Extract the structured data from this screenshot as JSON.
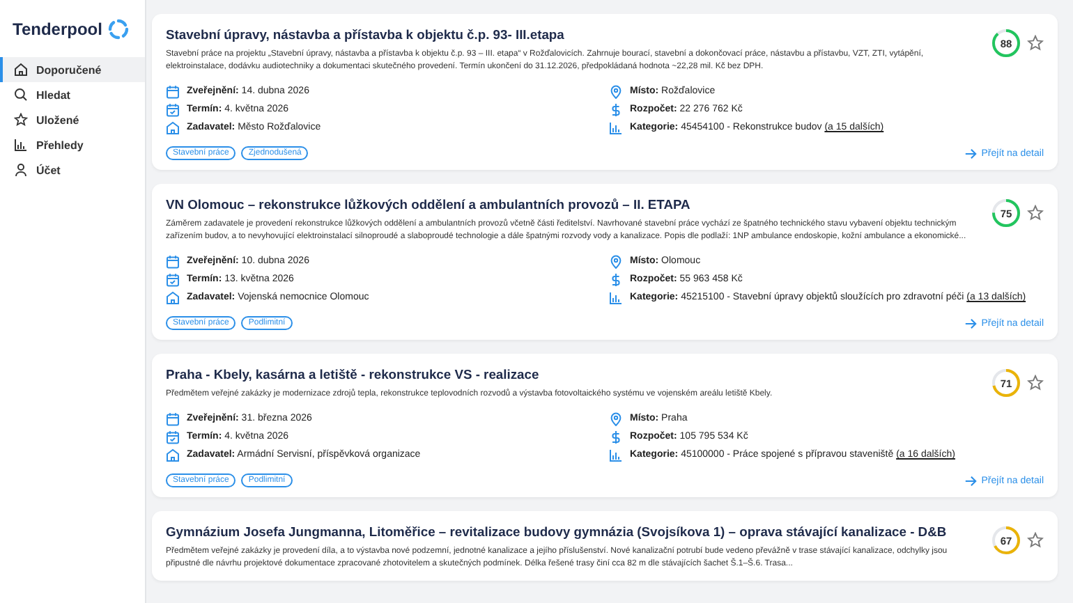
{
  "logo": {
    "text": "Tenderpool"
  },
  "sidebar": {
    "items": [
      {
        "label": "Doporučené",
        "selected": true
      },
      {
        "label": "Hledat",
        "selected": false
      },
      {
        "label": "Uložené",
        "selected": false
      },
      {
        "label": "Přehledy",
        "selected": false
      },
      {
        "label": "Účet",
        "selected": false
      }
    ]
  },
  "cards": [
    {
      "title": "Stavební úpravy, nástavba a přístavba k objektu č.p. 93- III.etapa",
      "score": "88",
      "color": "#22c55e",
      "description": "Stavební práce na projektu „Stavební úpravy, nástavba a přístavba k objektu č.p. 93 – III. etapa“ v Rožďalovicích. Zahrnuje bourací, stavební a dokončovací práce, nástavbu a přístavbu, VZT, ZTI, vytápění, elektroinstalace, dodávku audiotechniky a dokumentaci skutečného provedení. Termín ukončení do 31.12.2026, předpokládaná hodnota ~22,28 mil. Kč bez DPH.",
      "left": [
        {
          "label": "Zveřejnění:",
          "value": "14. dubna 2026"
        },
        {
          "label": "Termín:",
          "value": "4. května 2026"
        },
        {
          "label": "Zadavatel:",
          "value": "Město Rožďalovice"
        }
      ],
      "right": [
        {
          "label": "Místo:",
          "value": "Rožďalovice"
        },
        {
          "label": "Rozpočet:",
          "value": "22 276 762 Kč"
        },
        {
          "label": "Kategorie:",
          "value": "45454100 - Rekonstrukce budov",
          "more": "(a 15 dalších)"
        }
      ],
      "tags": [
        "Stavební práce",
        "Zjednodušená"
      ],
      "link": "Přejít na detail"
    },
    {
      "title": "VN Olomouc – rekonstrukce lůžkových oddělení a ambulantních provozů – II. ETAPA",
      "score": "75",
      "color": "#22c55e",
      "description": "Záměrem zadavatele je provedení rekonstrukce lůžkových oddělení a ambulantních provozů včetně části ředitelství. Navrhované stavební práce vychází ze špatného technického stavu vybavení objektu technickým zařízením budov, a to nevyhovující elektroinstalací silnoproudé a slaboproudé technologie a dále špatnými rozvody vody a kanalizace. Popis dle podlaží: 1NP ambulance endoskopie, kožní ambulance a ekonomické...",
      "left": [
        {
          "label": "Zveřejnění:",
          "value": "10. dubna 2026"
        },
        {
          "label": "Termín:",
          "value": "13. května 2026"
        },
        {
          "label": "Zadavatel:",
          "value": "Vojenská nemocnice Olomouc"
        }
      ],
      "right": [
        {
          "label": "Místo:",
          "value": "Olomouc"
        },
        {
          "label": "Rozpočet:",
          "value": "55 963 458 Kč"
        },
        {
          "label": "Kategorie:",
          "value": "45215100 - Stavební úpravy objektů sloužících pro zdravotní péči",
          "more": "(a 13 dalších)"
        }
      ],
      "tags": [
        "Stavební práce",
        "Podlimitní"
      ],
      "link": "Přejít na detail"
    },
    {
      "title": "Praha - Kbely, kasárna a letiště - rekonstrukce VS - realizace",
      "score": "71",
      "color": "#eab308",
      "description": "Předmětem veřejné zakázky je modernizace zdrojů tepla, rekonstrukce teplovodních rozvodů a výstavba fotovoltaického systému ve vojenském areálu letiště Kbely.",
      "left": [
        {
          "label": "Zveřejnění:",
          "value": "31. března 2026"
        },
        {
          "label": "Termín:",
          "value": "4. května 2026"
        },
        {
          "label": "Zadavatel:",
          "value": "Armádní Servisní, příspěvková organizace"
        }
      ],
      "right": [
        {
          "label": "Místo:",
          "value": "Praha"
        },
        {
          "label": "Rozpočet:",
          "value": "105 795 534 Kč"
        },
        {
          "label": "Kategorie:",
          "value": "45100000 - Práce spojené s přípravou staveniště",
          "more": "(a 16 dalších)"
        }
      ],
      "tags": [
        "Stavební práce",
        "Podlimitní"
      ],
      "link": "Přejít na detail"
    },
    {
      "title": "Gymnázium Josefa Jungmanna, Litoměřice – revitalizace budovy gymnázia (Svojsíkova 1) – oprava stávající kanalizace - D&B",
      "score": "67",
      "color": "#eab308",
      "description": "Předmětem veřejné zakázky je provedení díla, a to výstavba nové podzemní, jednotné kanalizace a jejího příslušenství. Nové kanalizační potrubí bude vedeno převážně v trase stávající kanalizace, odchylky jsou připustné dle návrhu projektové dokumentace zpracované zhotovitelem a skutečných podmínek. Délka řešené trasy činí cca 82 m dle stávajících šachet Š.1–Š.6. Trasa..."
    }
  ]
}
